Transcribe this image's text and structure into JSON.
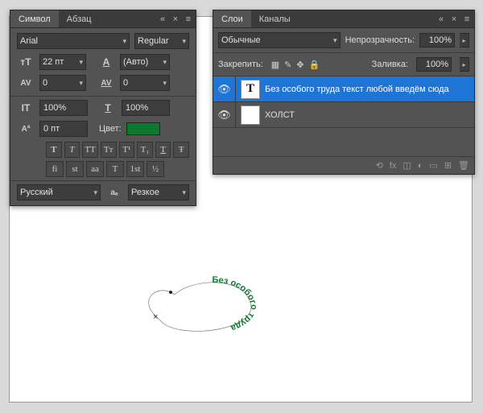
{
  "symbol_panel": {
    "tabs": {
      "symbol": "Символ",
      "paragraph": "Абзац"
    },
    "font_family": "Arial",
    "font_style": "Regular",
    "size_icon": "тТ",
    "size": "22 пт",
    "leading_icon": "A",
    "leading": "(Авто)",
    "kerning_icon": "AV",
    "kerning": "0",
    "tracking_icon": "AV",
    "tracking": "0",
    "vscale_icon": "IT",
    "vscale": "100%",
    "hscale_icon": "T",
    "hscale": "100%",
    "baseline_icon": "Aª",
    "baseline": "0 пт",
    "color_label": "Цвет:",
    "color_value": "#0b7a2e",
    "style_btns": {
      "b": "T",
      "i": "T",
      "caps": "TT",
      "small": "Tт",
      "sup": "T¹",
      "sub": "T₁",
      "under": "T",
      "strike": "Ŧ"
    },
    "lig_btns": {
      "a": "fi",
      "b": "st",
      "c": "aa",
      "d": "T",
      "e": "1st",
      "f": "½"
    },
    "lang": "Русский",
    "aa_icon": "aₐ",
    "antialias": "Резкое"
  },
  "layers_panel": {
    "tabs": {
      "layers": "Слои",
      "channels": "Каналы"
    },
    "mode": "Обычные",
    "opacity_label": "Непрозрачность:",
    "opacity": "100%",
    "lock_label": "Закрепить:",
    "fill_label": "Заливка:",
    "fill": "100%",
    "layers": [
      {
        "thumb": "T",
        "name": "Без особого труда текст любой введём сюда",
        "selected": true
      },
      {
        "thumb": "",
        "name": "ХОЛСТ",
        "selected": false
      }
    ],
    "footer_icons": {
      "link": "⟲",
      "fx": "fx",
      "mask": "◫",
      "adj": "◐",
      "group": "▭",
      "new": "⊞",
      "trash": "🗑"
    }
  },
  "canvas_text": "Без особого труда"
}
